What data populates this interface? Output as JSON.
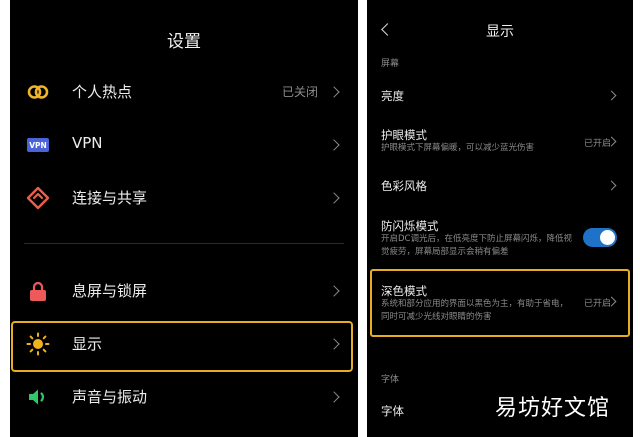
{
  "colors": {
    "background": "#000000",
    "highlight": "#e6ad1e",
    "toggle_on": "#1e73c8"
  },
  "left": {
    "title": "设置",
    "items": [
      {
        "label": "个人热点",
        "value": "已关闭",
        "icon": "hotspot-icon"
      },
      {
        "label": "VPN",
        "value": "",
        "icon": "vpn-icon",
        "icon_text": "VPN"
      },
      {
        "label": "连接与共享",
        "value": "",
        "icon": "connection-share-icon"
      },
      {
        "label": "息屏与锁屏",
        "value": "",
        "icon": "lock-icon"
      },
      {
        "label": "显示",
        "value": "",
        "icon": "sun-icon",
        "highlighted": true
      },
      {
        "label": "声音与振动",
        "value": "",
        "icon": "speaker-icon"
      }
    ]
  },
  "right": {
    "back_icon": "back-arrow-icon",
    "title": "显示",
    "section_screen": "屏幕",
    "brightness": {
      "label": "亮度"
    },
    "eye_care": {
      "label": "护眼模式",
      "desc": "护眼模式下屏幕偏暖，可以减少蓝光伤害",
      "value": "已开启"
    },
    "color_style": {
      "label": "色彩风格"
    },
    "anti_flicker": {
      "label": "防闪烁模式",
      "desc": "开启DC调光后，在低亮度下防止屏幕闪烁，降低视觉疲劳，屏幕局部显示会稍有偏差",
      "enabled": true
    },
    "dark_mode": {
      "label": "深色模式",
      "desc": "系统和部分应用的界面以黑色为主，有助于省电，同时可减少光线对眼睛的伤害",
      "value": "已开启",
      "highlighted": true
    },
    "section_font": "字体",
    "font": {
      "label": "字体"
    },
    "watermark": "易坊好文馆"
  }
}
